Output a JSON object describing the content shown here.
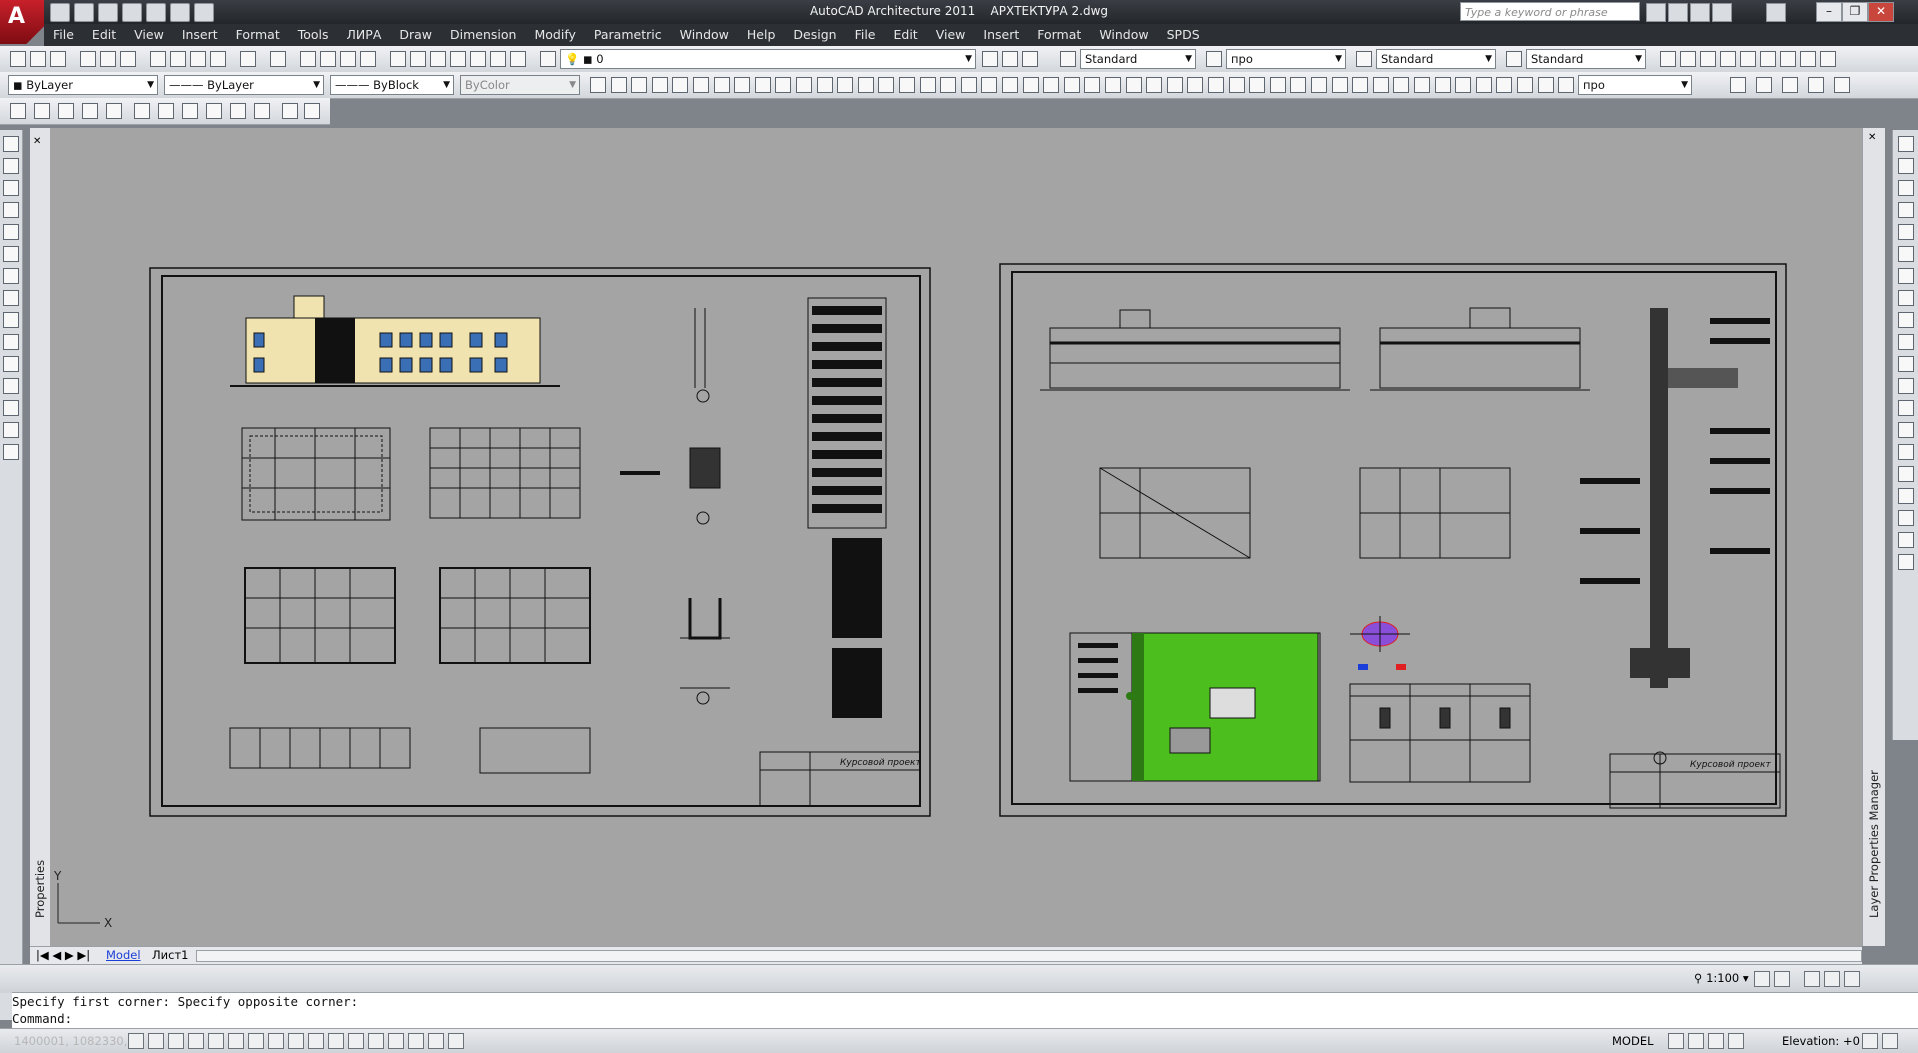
{
  "app": {
    "title": "AutoCAD Architecture 2011",
    "filename": "АРХТЕКТУРА 2.dwg",
    "logo_letter": "A",
    "search_placeholder": "Type a keyword or phrase"
  },
  "menu": [
    "File",
    "Edit",
    "View",
    "Insert",
    "Format",
    "Tools",
    "ЛИРА",
    "Draw",
    "Dimension",
    "Modify",
    "Parametric",
    "Window",
    "Help",
    "Design",
    "File",
    "Edit",
    "View",
    "Insert",
    "Format",
    "Window",
    "SPDS"
  ],
  "toolbar": {
    "layer_value": "0",
    "text_style": "Standard",
    "dim_style": "про",
    "table_style": "Standard",
    "mleader_style": "Standard",
    "layer_combo": "ByLayer",
    "linetype_combo": "ByLayer",
    "lineweight_combo": "ByBlock",
    "plotstyle_combo": "ByColor",
    "dim_style2": "про"
  },
  "left_palette_label": "Properties",
  "right_palette_label": "Layer Properties Manager",
  "sheets": {
    "left_title_block": "Курсовой проект",
    "right_title_block": "Курсовой проект"
  },
  "tabs": {
    "model": "Model",
    "layout": "Лист1"
  },
  "command": {
    "history": "Specify first corner: Specify opposite corner:",
    "prompt": "Command:"
  },
  "status": {
    "coords": "1400001, 1082330, 0",
    "model_label": "MODEL",
    "scale": "1:100",
    "elevation": "Elevation: +0"
  },
  "ucs": {
    "x": "X",
    "y": "Y"
  },
  "colors": {
    "canvas": "#a4a4a4",
    "site_green": "#4cbf1f",
    "facade_yellow": "#f0e3b0",
    "title_bar": "#2c3035"
  }
}
